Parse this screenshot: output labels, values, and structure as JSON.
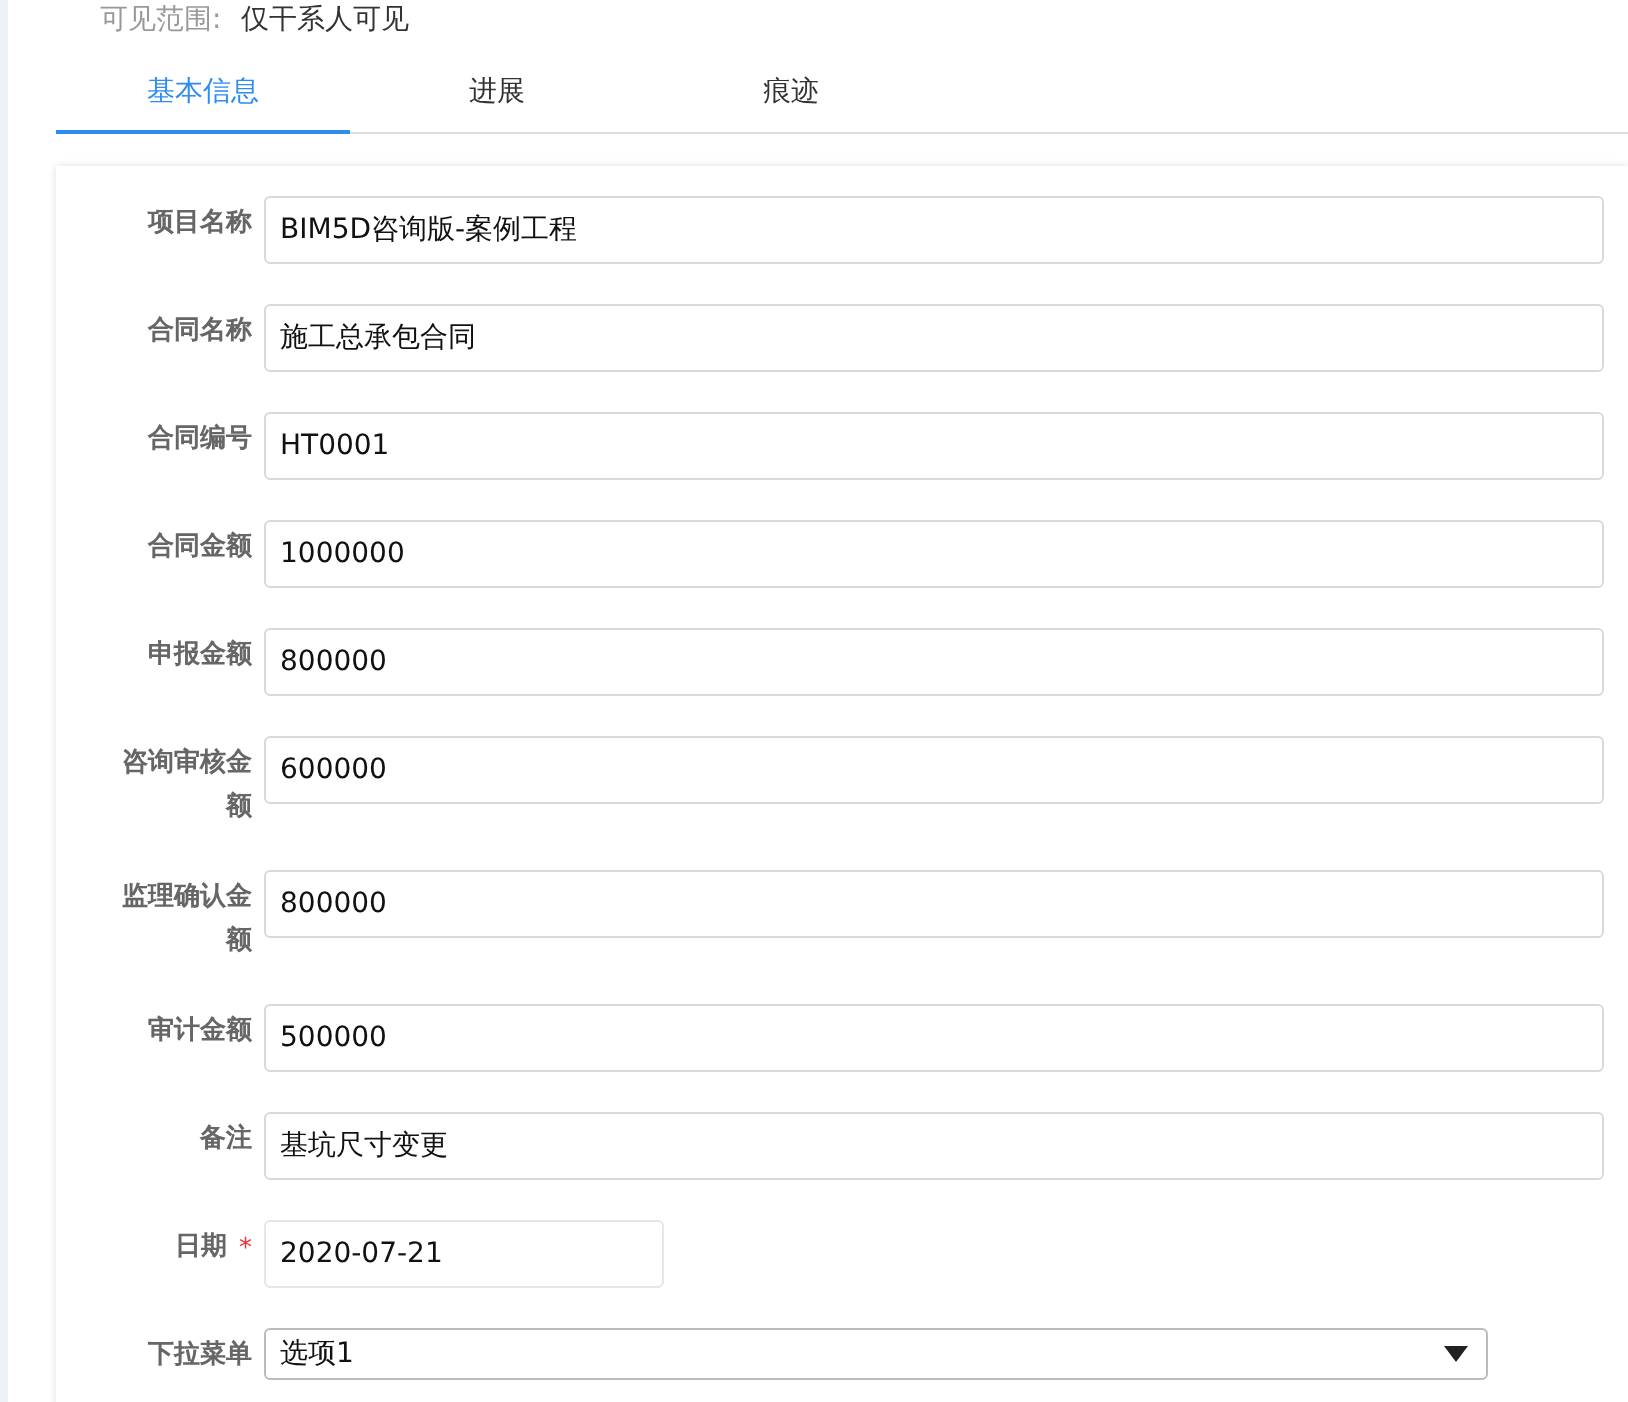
{
  "visibility": {
    "label": "可见范围:",
    "value": "仅干系人可见"
  },
  "tabs": [
    {
      "label": "基本信息",
      "selected": true
    },
    {
      "label": "进展",
      "selected": false
    },
    {
      "label": "痕迹",
      "selected": false
    }
  ],
  "fields": [
    {
      "kind": "text",
      "label": "项目名称",
      "value": "BIM5D咨询版-案例工程",
      "required": false
    },
    {
      "kind": "text",
      "label": "合同名称",
      "value": "施工总承包合同",
      "required": false
    },
    {
      "kind": "text",
      "label": "合同编号",
      "value": "HT0001",
      "required": false
    },
    {
      "kind": "text",
      "label": "合同金额",
      "value": "1000000",
      "required": false
    },
    {
      "kind": "text",
      "label": "申报金额",
      "value": "800000",
      "required": false
    },
    {
      "kind": "text",
      "label": "咨询审核金额",
      "value": "600000",
      "required": false
    },
    {
      "kind": "text",
      "label": "监理确认金额",
      "value": "800000",
      "required": false
    },
    {
      "kind": "text",
      "label": "审计金额",
      "value": "500000",
      "required": false
    },
    {
      "kind": "text",
      "label": "备注",
      "value": "基坑尺寸变更",
      "required": false
    },
    {
      "kind": "date",
      "label": "日期",
      "value": "2020-07-21",
      "required": true,
      "required_mark": "*"
    },
    {
      "kind": "select",
      "label": "下拉菜单",
      "value": "选项1",
      "required": false
    }
  ]
}
